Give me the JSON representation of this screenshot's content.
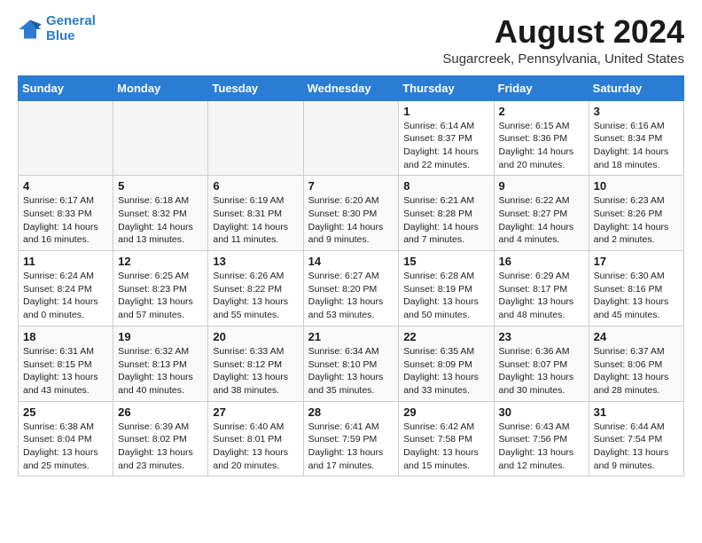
{
  "header": {
    "logo_line1": "General",
    "logo_line2": "Blue",
    "main_title": "August 2024",
    "subtitle": "Sugarcreek, Pennsylvania, United States"
  },
  "weekdays": [
    "Sunday",
    "Monday",
    "Tuesday",
    "Wednesday",
    "Thursday",
    "Friday",
    "Saturday"
  ],
  "weeks": [
    [
      {
        "day": "",
        "info": ""
      },
      {
        "day": "",
        "info": ""
      },
      {
        "day": "",
        "info": ""
      },
      {
        "day": "",
        "info": ""
      },
      {
        "day": "1",
        "info": "Sunrise: 6:14 AM\nSunset: 8:37 PM\nDaylight: 14 hours and 22 minutes."
      },
      {
        "day": "2",
        "info": "Sunrise: 6:15 AM\nSunset: 8:36 PM\nDaylight: 14 hours and 20 minutes."
      },
      {
        "day": "3",
        "info": "Sunrise: 6:16 AM\nSunset: 8:34 PM\nDaylight: 14 hours and 18 minutes."
      }
    ],
    [
      {
        "day": "4",
        "info": "Sunrise: 6:17 AM\nSunset: 8:33 PM\nDaylight: 14 hours and 16 minutes."
      },
      {
        "day": "5",
        "info": "Sunrise: 6:18 AM\nSunset: 8:32 PM\nDaylight: 14 hours and 13 minutes."
      },
      {
        "day": "6",
        "info": "Sunrise: 6:19 AM\nSunset: 8:31 PM\nDaylight: 14 hours and 11 minutes."
      },
      {
        "day": "7",
        "info": "Sunrise: 6:20 AM\nSunset: 8:30 PM\nDaylight: 14 hours and 9 minutes."
      },
      {
        "day": "8",
        "info": "Sunrise: 6:21 AM\nSunset: 8:28 PM\nDaylight: 14 hours and 7 minutes."
      },
      {
        "day": "9",
        "info": "Sunrise: 6:22 AM\nSunset: 8:27 PM\nDaylight: 14 hours and 4 minutes."
      },
      {
        "day": "10",
        "info": "Sunrise: 6:23 AM\nSunset: 8:26 PM\nDaylight: 14 hours and 2 minutes."
      }
    ],
    [
      {
        "day": "11",
        "info": "Sunrise: 6:24 AM\nSunset: 8:24 PM\nDaylight: 14 hours and 0 minutes."
      },
      {
        "day": "12",
        "info": "Sunrise: 6:25 AM\nSunset: 8:23 PM\nDaylight: 13 hours and 57 minutes."
      },
      {
        "day": "13",
        "info": "Sunrise: 6:26 AM\nSunset: 8:22 PM\nDaylight: 13 hours and 55 minutes."
      },
      {
        "day": "14",
        "info": "Sunrise: 6:27 AM\nSunset: 8:20 PM\nDaylight: 13 hours and 53 minutes."
      },
      {
        "day": "15",
        "info": "Sunrise: 6:28 AM\nSunset: 8:19 PM\nDaylight: 13 hours and 50 minutes."
      },
      {
        "day": "16",
        "info": "Sunrise: 6:29 AM\nSunset: 8:17 PM\nDaylight: 13 hours and 48 minutes."
      },
      {
        "day": "17",
        "info": "Sunrise: 6:30 AM\nSunset: 8:16 PM\nDaylight: 13 hours and 45 minutes."
      }
    ],
    [
      {
        "day": "18",
        "info": "Sunrise: 6:31 AM\nSunset: 8:15 PM\nDaylight: 13 hours and 43 minutes."
      },
      {
        "day": "19",
        "info": "Sunrise: 6:32 AM\nSunset: 8:13 PM\nDaylight: 13 hours and 40 minutes."
      },
      {
        "day": "20",
        "info": "Sunrise: 6:33 AM\nSunset: 8:12 PM\nDaylight: 13 hours and 38 minutes."
      },
      {
        "day": "21",
        "info": "Sunrise: 6:34 AM\nSunset: 8:10 PM\nDaylight: 13 hours and 35 minutes."
      },
      {
        "day": "22",
        "info": "Sunrise: 6:35 AM\nSunset: 8:09 PM\nDaylight: 13 hours and 33 minutes."
      },
      {
        "day": "23",
        "info": "Sunrise: 6:36 AM\nSunset: 8:07 PM\nDaylight: 13 hours and 30 minutes."
      },
      {
        "day": "24",
        "info": "Sunrise: 6:37 AM\nSunset: 8:06 PM\nDaylight: 13 hours and 28 minutes."
      }
    ],
    [
      {
        "day": "25",
        "info": "Sunrise: 6:38 AM\nSunset: 8:04 PM\nDaylight: 13 hours and 25 minutes."
      },
      {
        "day": "26",
        "info": "Sunrise: 6:39 AM\nSunset: 8:02 PM\nDaylight: 13 hours and 23 minutes."
      },
      {
        "day": "27",
        "info": "Sunrise: 6:40 AM\nSunset: 8:01 PM\nDaylight: 13 hours and 20 minutes."
      },
      {
        "day": "28",
        "info": "Sunrise: 6:41 AM\nSunset: 7:59 PM\nDaylight: 13 hours and 17 minutes."
      },
      {
        "day": "29",
        "info": "Sunrise: 6:42 AM\nSunset: 7:58 PM\nDaylight: 13 hours and 15 minutes."
      },
      {
        "day": "30",
        "info": "Sunrise: 6:43 AM\nSunset: 7:56 PM\nDaylight: 13 hours and 12 minutes."
      },
      {
        "day": "31",
        "info": "Sunrise: 6:44 AM\nSunset: 7:54 PM\nDaylight: 13 hours and 9 minutes."
      }
    ]
  ]
}
